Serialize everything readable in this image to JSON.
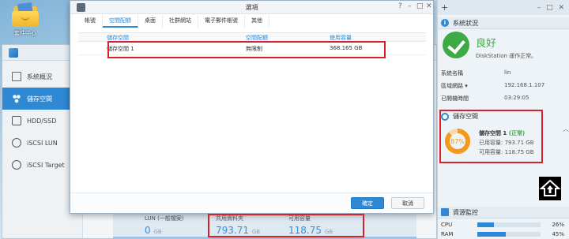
{
  "desktop": {
    "icon_label": "套件中心"
  },
  "storage_manager": {
    "sidebar": [
      {
        "label": "系統概況",
        "icon": "overview-icon"
      },
      {
        "label": "儲存空間",
        "icon": "volume-icon",
        "active": true
      },
      {
        "label": "HDD/SSD",
        "icon": "disk-icon"
      },
      {
        "label": "iSCSI LUN",
        "icon": "iscsi-icon"
      },
      {
        "label": "iSCSI Target",
        "icon": "iscsi-icon"
      }
    ],
    "bottom": {
      "lun_label": "LUN (一般檔案)",
      "lun_value": "0",
      "lun_unit": "GB",
      "shared_label": "共用資料夾",
      "shared_value": "793.71",
      "shared_unit": "GB",
      "avail_label": "可用容量",
      "avail_value": "118.75",
      "avail_unit": "GB"
    }
  },
  "dialog": {
    "title": "選項",
    "controls": {
      "help": "?",
      "minimize": "–",
      "maximize": "□",
      "close": "✕"
    },
    "tabs": [
      "帳號",
      "空間配額",
      "桌面",
      "社群網站",
      "電子郵件帳號",
      "其他"
    ],
    "active_tab": 1,
    "columns": {
      "volume": "儲存空間",
      "quota": "空間配額",
      "used": "使用容量"
    },
    "rows": [
      {
        "volume": "儲存空間 1",
        "quota": "無限制",
        "used": "368.165 GB"
      }
    ],
    "ok_label": "確定",
    "cancel_label": "取消"
  },
  "panel": {
    "plus": "+",
    "window_controls": "– □ ✕",
    "system_health": {
      "title": "系統狀況",
      "status": "良好",
      "subtitle": "DiskStation 運作正常。",
      "server_name_label": "系統名稱",
      "server_name": "lin",
      "lan_label": "區域網路 ▾",
      "lan_ip": "192.168.1.107",
      "uptime_label": "已開機時間",
      "uptime": "03:29:05"
    },
    "storage": {
      "title": "儲存空間",
      "percent": 87,
      "percent_text": "87%",
      "volume_name": "儲存空間 1",
      "volume_status": "(正常)",
      "used_label": "已用容量:",
      "used_value": "793.71 GB",
      "avail_label": "可用容量:",
      "avail_value": "118.75 GB"
    },
    "resource": {
      "title": "資源監控",
      "cpu_label": "CPU",
      "cpu_percent": 26,
      "cpu_text": "26%",
      "ram_label": "RAM",
      "ram_percent": 45,
      "ram_text": "45%"
    }
  },
  "colors": {
    "accent": "#2e88d4",
    "highlight": "#d81f2c",
    "ok": "#3fa945",
    "donut": "#f39a1e"
  }
}
